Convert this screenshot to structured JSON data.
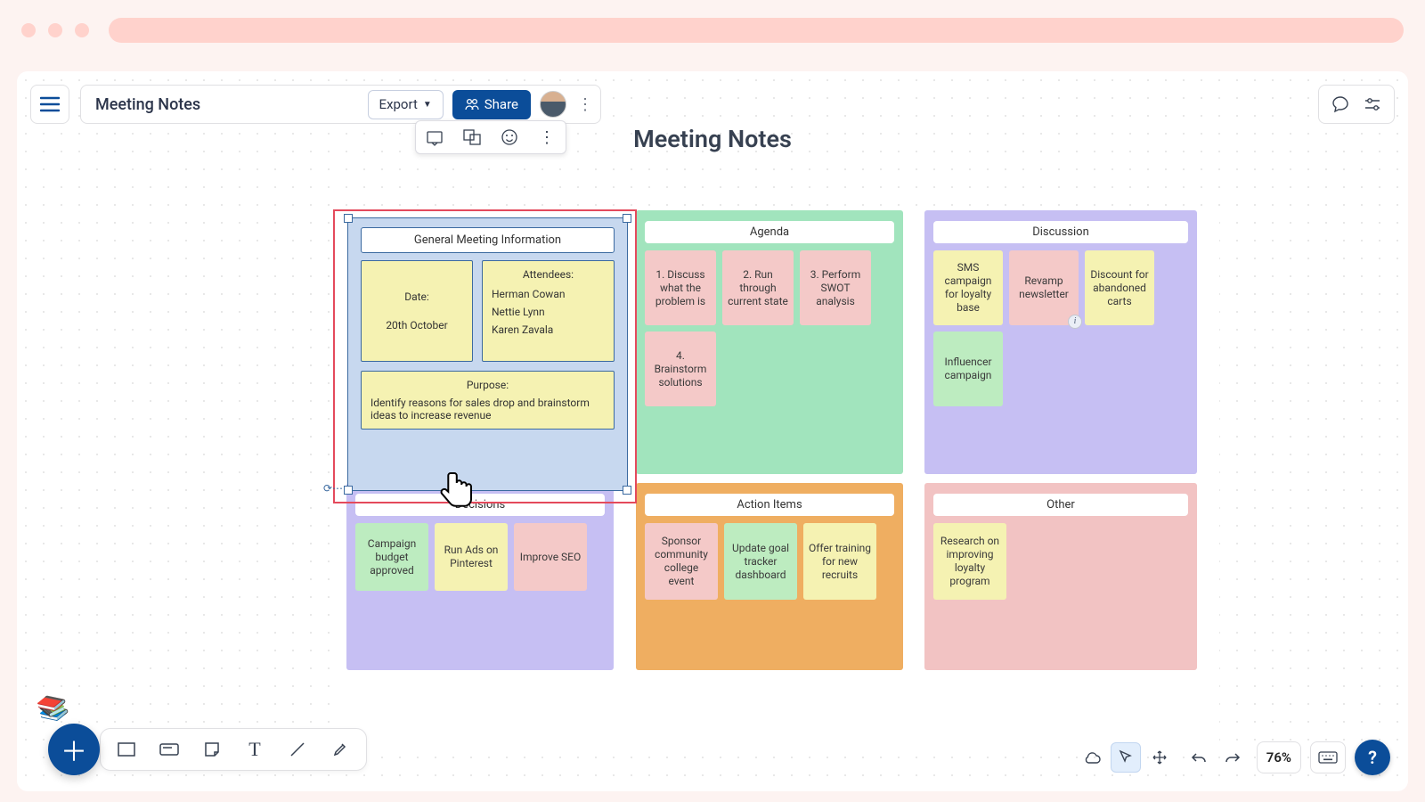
{
  "doc": {
    "title": "Meeting Notes",
    "canvas_title": "Meeting Notes",
    "export_label": "Export",
    "share_label": "Share"
  },
  "general_info": {
    "header": "General Meeting Information",
    "date_label": "Date:",
    "date_value": "20th October",
    "attendees_label": "Attendees:",
    "attendees": [
      "Herman Cowan",
      "Nettie Lynn",
      "Karen Zavala"
    ],
    "purpose_label": "Purpose:",
    "purpose_text": "Identify reasons for sales drop and brainstorm ideas to increase revenue"
  },
  "sections": {
    "agenda": {
      "title": "Agenda",
      "items": [
        "1. Discuss what the problem is",
        "2. Run through current state",
        "3. Perform SWOT analysis",
        "4. Brainstorm solutions"
      ]
    },
    "discussion": {
      "title": "Discussion",
      "items": [
        "SMS campaign for loyalty base",
        "Revamp newsletter",
        "Discount for abandoned carts",
        "Influencer campaign"
      ]
    },
    "decisions": {
      "title": "Decisions",
      "items": [
        "Campaign budget approved",
        "Run Ads on Pinterest",
        "Improve SEO"
      ]
    },
    "action_items": {
      "title": "Action Items",
      "items": [
        "Sponsor community college event",
        "Update goal tracker dashboard",
        "Offer training for new recruits"
      ]
    },
    "other": {
      "title": "Other",
      "items": [
        "Research on improving loyalty program"
      ]
    }
  },
  "zoom": "76%",
  "colors": {
    "accent": "#0b4d99",
    "select_outline": "#e44a5c"
  }
}
